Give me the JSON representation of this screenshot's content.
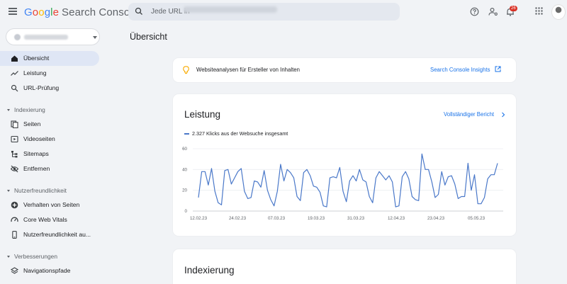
{
  "header": {
    "logo_google": [
      "G",
      "o",
      "o",
      "g",
      "l",
      "e"
    ],
    "product": "Search Console",
    "search_placeholder": "Jede URL in",
    "notification_count": "26",
    "icons": [
      "help-icon",
      "manage-users-icon",
      "notifications-icon",
      "apps-icon"
    ]
  },
  "sidebar": {
    "top_items": [
      {
        "label": "Übersicht",
        "icon": "home-icon",
        "active": true
      },
      {
        "label": "Leistung",
        "icon": "trending-up-icon"
      },
      {
        "label": "URL-Prüfung",
        "icon": "search-icon"
      }
    ],
    "sections": [
      {
        "title": "Indexierung",
        "items": [
          {
            "label": "Seiten",
            "icon": "pages-icon"
          },
          {
            "label": "Videoseiten",
            "icon": "video-icon"
          },
          {
            "label": "Sitemaps",
            "icon": "sitemap-icon"
          },
          {
            "label": "Entfernen",
            "icon": "remove-visibility-icon"
          }
        ]
      },
      {
        "title": "Nutzerfreundlichkeit",
        "items": [
          {
            "label": "Verhalten von Seiten",
            "icon": "page-experience-icon"
          },
          {
            "label": "Core Web Vitals",
            "icon": "speed-gauge-icon"
          },
          {
            "label": "Nutzerfreundlichkeit au...",
            "icon": "mobile-icon"
          }
        ]
      },
      {
        "title": "Verbesserungen",
        "items": [
          {
            "label": "Navigationspfade",
            "icon": "layers-icon"
          }
        ]
      }
    ]
  },
  "main": {
    "page_title": "Übersicht",
    "insights": {
      "text": "Websiteanalysen für Ersteller von Inhalten",
      "link": "Search Console Insights"
    },
    "performance": {
      "title": "Leistung",
      "link": "Vollständiger Bericht",
      "legend": "2.327 Klicks aus der Websuche insgesamt"
    },
    "indexing": {
      "title": "Indexierung"
    }
  },
  "colors": {
    "accent": "#1a73e8",
    "series": "#4a78c9",
    "active_nav": "#dfe6f5",
    "badge": "#d93025"
  },
  "chart_data": {
    "type": "line",
    "x_ticks": [
      "12.02.23",
      "24.02.23",
      "07.03.23",
      "19.03.23",
      "31.03.23",
      "12.04.23",
      "23.04.23",
      "05.05.23"
    ],
    "y_ticks": [
      0,
      20,
      40,
      60
    ],
    "ylim": [
      0,
      60
    ],
    "grid": true,
    "series": [
      {
        "name": "2.327 Klicks aus der Websuche insgesamt",
        "values": [
          13,
          38,
          38,
          25,
          41,
          19,
          8,
          6,
          39,
          40,
          26,
          32,
          38,
          41,
          19,
          12,
          13,
          29,
          28,
          23,
          39,
          20,
          11,
          5,
          19,
          45,
          29,
          40,
          37,
          32,
          14,
          10,
          37,
          40,
          34,
          24,
          23,
          18,
          5,
          4,
          32,
          33,
          32,
          42,
          19,
          9,
          29,
          34,
          29,
          40,
          30,
          28,
          14,
          8,
          32,
          38,
          34,
          30,
          34,
          28,
          4,
          5,
          33,
          38,
          31,
          14,
          11,
          10,
          55,
          40,
          40,
          28,
          13,
          16,
          38,
          25,
          33,
          34,
          26,
          12,
          14,
          14,
          46,
          20,
          35,
          7,
          7,
          13,
          31,
          35,
          35,
          46
        ]
      }
    ]
  }
}
